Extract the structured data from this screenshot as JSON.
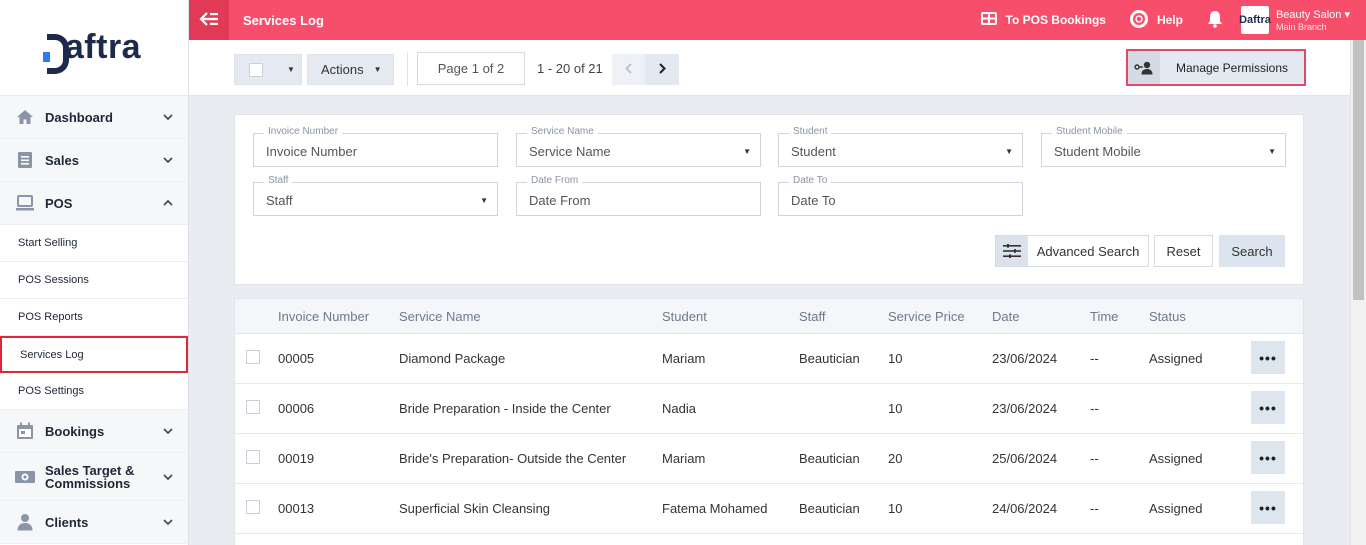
{
  "brand": {
    "logo_text": "aftra"
  },
  "sidebar": {
    "items": [
      {
        "label": "Dashboard",
        "icon": "home-icon"
      },
      {
        "label": "Sales",
        "icon": "sales-icon"
      },
      {
        "label": "POS",
        "icon": "pos-icon"
      }
    ],
    "pos_sub": [
      {
        "label": "Start Selling"
      },
      {
        "label": "POS Sessions"
      },
      {
        "label": "POS Reports"
      },
      {
        "label": "Services Log"
      },
      {
        "label": "POS Settings"
      }
    ],
    "items_after": [
      {
        "label": "Bookings",
        "icon": "calendar-icon"
      },
      {
        "label": "Sales Target & Commissions",
        "icon": "money-icon"
      },
      {
        "label": "Clients",
        "icon": "user-icon"
      }
    ]
  },
  "topbar": {
    "title": "Services Log",
    "pos_bookings": "To POS Bookings",
    "help": "Help",
    "account_name": "Beauty Salon",
    "account_branch": "Main Branch",
    "avatar_text": "Daftra"
  },
  "toolbar": {
    "actions_label": "Actions",
    "page_label": "Page 1 of 2",
    "range_label": "1 - 20 of 21",
    "permissions_label": "Manage Permissions"
  },
  "filters": {
    "invoice_number": {
      "label": "Invoice Number",
      "placeholder": "Invoice Number"
    },
    "service_name": {
      "label": "Service Name",
      "value": "Service Name"
    },
    "student": {
      "label": "Student",
      "value": "Student"
    },
    "student_mobile": {
      "label": "Student Mobile",
      "value": "Student Mobile"
    },
    "staff": {
      "label": "Staff",
      "value": "Staff"
    },
    "date_from": {
      "label": "Date From",
      "placeholder": "Date From"
    },
    "date_to": {
      "label": "Date To",
      "placeholder": "Date To"
    },
    "advanced_search": "Advanced Search",
    "reset": "Reset",
    "search": "Search"
  },
  "table": {
    "headers": [
      "Invoice Number",
      "Service Name",
      "Student",
      "Staff",
      "Service Price",
      "Date",
      "Time",
      "Status"
    ],
    "rows": [
      {
        "invoice": "00005",
        "service": "Diamond Package",
        "student": "Mariam",
        "staff": "Beautician",
        "price": "10",
        "date": "23/06/2024",
        "time": "--",
        "status": "Assigned"
      },
      {
        "invoice": "00006",
        "service": "Bride Preparation - Inside the Center",
        "student": "Nadia",
        "staff": "",
        "price": "10",
        "date": "23/06/2024",
        "time": "--",
        "status": ""
      },
      {
        "invoice": "00019",
        "service": "Bride's Preparation- Outside the Center",
        "student": "Mariam",
        "staff": "Beautician",
        "price": "20",
        "date": "25/06/2024",
        "time": "--",
        "status": "Assigned"
      },
      {
        "invoice": "00013",
        "service": "Superficial Skin Cleansing",
        "student": "Fatema Mohamed",
        "staff": "Beautician",
        "price": "10",
        "date": "24/06/2024",
        "time": "--",
        "status": "Assigned"
      }
    ]
  },
  "colors": {
    "topbar": "#f74e6c",
    "accent_blue": "#2a7bf4",
    "highlight_red": "#e0243a"
  }
}
